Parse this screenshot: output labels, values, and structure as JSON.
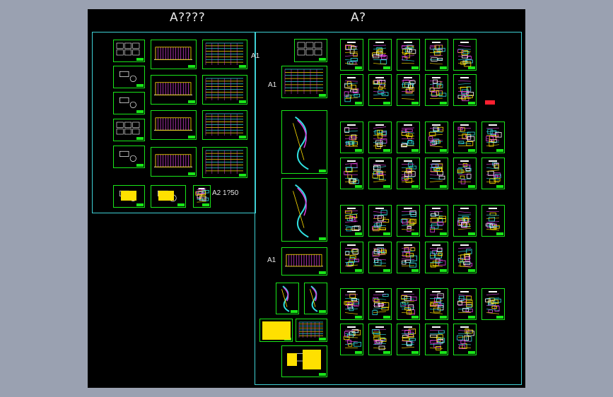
{
  "titles": {
    "left_group": "A????",
    "right_group": "A?"
  },
  "labels": {
    "a1_top": "A1",
    "a1_second": "A1",
    "a1_third": "A1",
    "a2_scale": "A2 1?50"
  },
  "colors": {
    "background": "#9aa1b1",
    "canvas": "#000000",
    "frame": "#19e619",
    "region_border": "#3fd1d6",
    "accent_yellow": "#ffe000",
    "accent_magenta": "#e040e0",
    "accent_red": "#ff2030",
    "accent_cyan": "#30e0e0"
  }
}
